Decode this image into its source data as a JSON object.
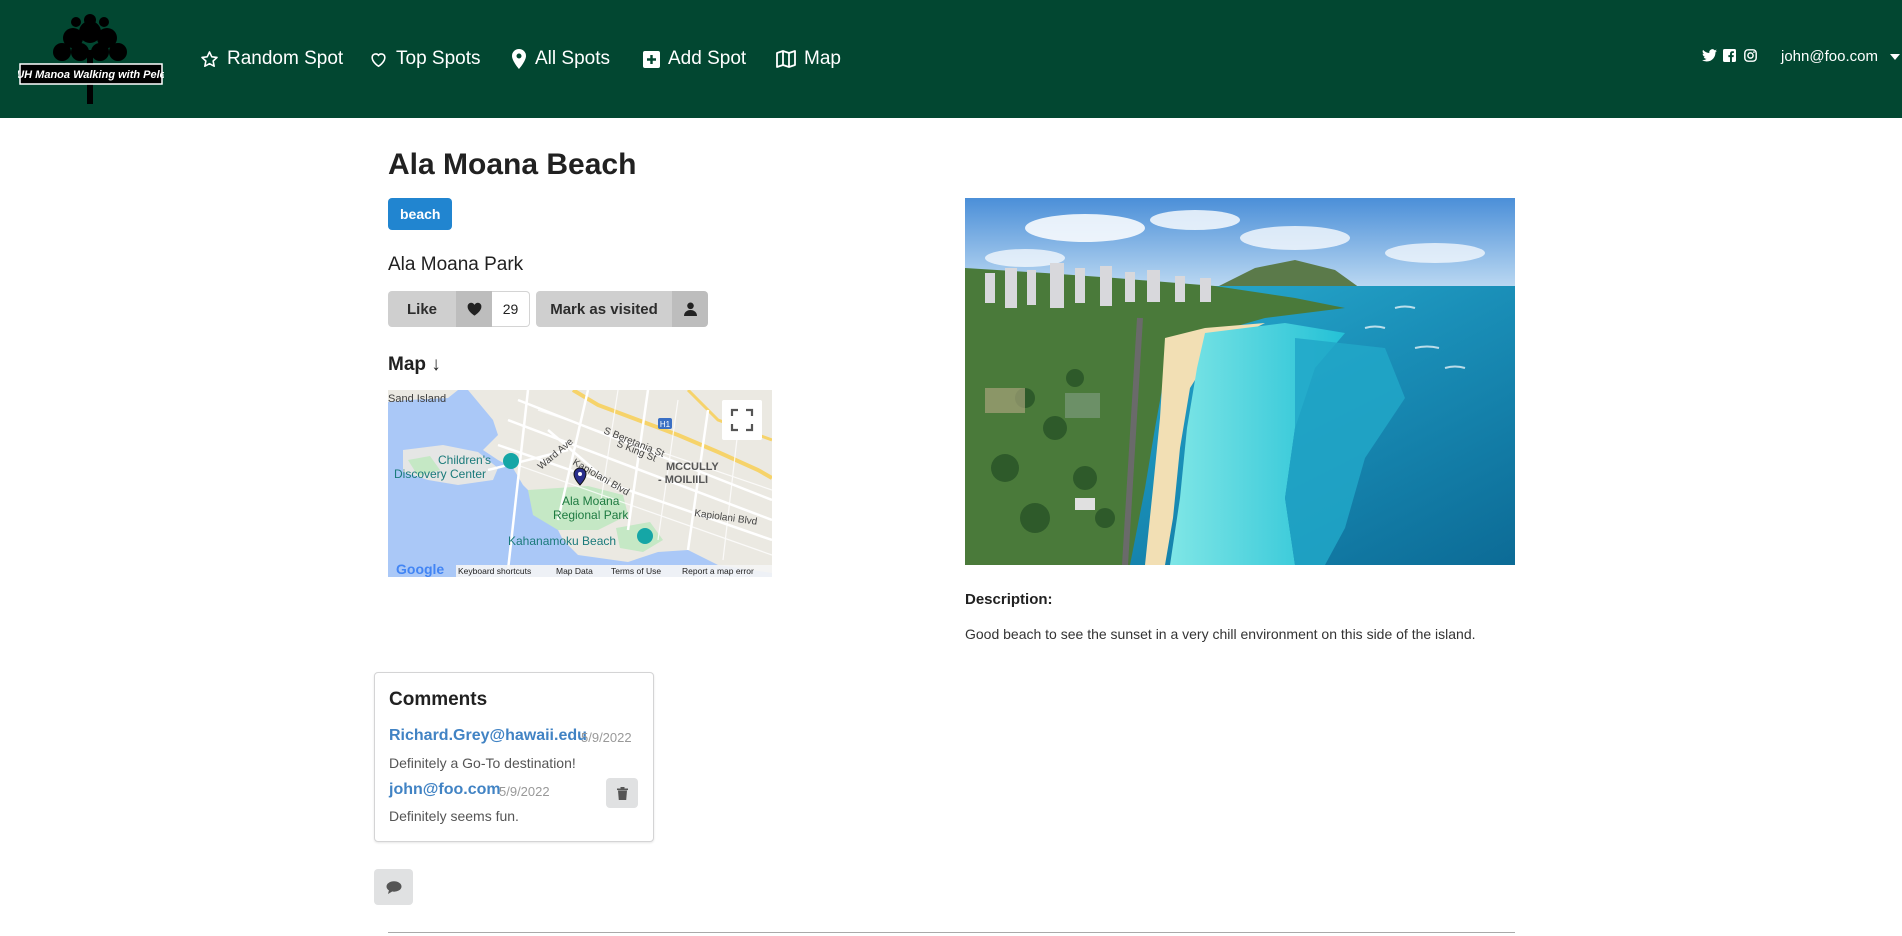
{
  "header": {
    "logo_text": "UH Manoa Walking with Pele",
    "nav": [
      {
        "label": "Random Spot",
        "icon": "star-outline-icon"
      },
      {
        "label": "Top Spots",
        "icon": "heart-outline-icon"
      },
      {
        "label": "All Spots",
        "icon": "map-marker-icon"
      },
      {
        "label": "Add Spot",
        "icon": "plus-square-icon"
      },
      {
        "label": "Map",
        "icon": "map-outline-icon"
      }
    ],
    "social_icons": [
      "twitter-icon",
      "facebook-icon",
      "instagram-icon"
    ],
    "user_email": "john@foo.com",
    "colors": {
      "header_bg": "#024731",
      "header_text": "#ffffff"
    }
  },
  "spot": {
    "title": "Ala Moana Beach",
    "tag": "beach",
    "location": "Ala Moana Park",
    "like_label": "Like",
    "like_count": "29",
    "visited_label": "Mark as visited",
    "map_heading": "Map ↓",
    "description_label": "Description:",
    "description": "Good beach to see the sunset in a very chill environment on this side of the island.",
    "colors": {
      "tag": "#2185d0",
      "button": "#cfcfcf"
    }
  },
  "map": {
    "labels": {
      "sand_island": "Sand Island",
      "childrens_line1": "Children's",
      "childrens_line2": "Discovery Center",
      "s_beretania": "S Beretania St",
      "s_king": "S King St",
      "ward_ave": "Ward Ave",
      "kapiolani_blvd": "Kapiolani Blvd",
      "kapiolani_blvd_2": "Kapiolani Blvd",
      "mccully_line1": "MCCULLY",
      "mccully_line2": "- MOILIILI",
      "ala_moana_line1": "Ala Moana",
      "ala_moana_line2": "Regional Park",
      "kahanamoku": "Kahanamoku Beach",
      "h1": "H1"
    },
    "google_logo": "Google",
    "footer_links": [
      "Keyboard shortcuts",
      "Map Data",
      "Terms of Use",
      "Report a map error"
    ]
  },
  "comments": {
    "title": "Comments",
    "items": [
      {
        "author": "Richard.Grey@hawaii.edu",
        "date": "5/9/2022",
        "text": "Definitely a Go-To destination!"
      },
      {
        "author": "john@foo.com",
        "date": "5/9/2022",
        "text": "Definitely seems fun."
      }
    ]
  }
}
